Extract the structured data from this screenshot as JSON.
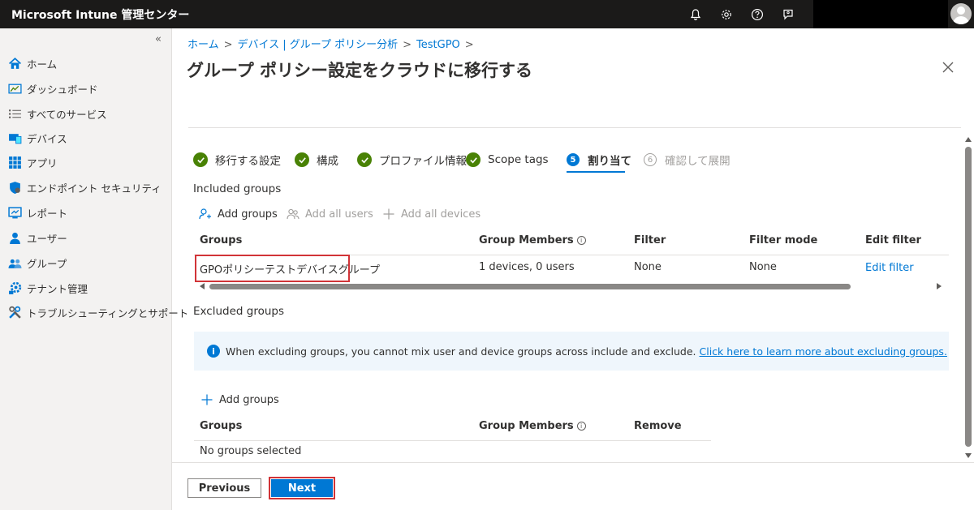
{
  "app": {
    "title": "Microsoft Intune 管理センター"
  },
  "topbar": {
    "icons": [
      "bell-icon",
      "gear-icon",
      "help-icon",
      "feedback-icon"
    ]
  },
  "sidebar": {
    "collapse": "«",
    "items": [
      {
        "label": "ホーム",
        "icon": "home-icon"
      },
      {
        "label": "ダッシュボード",
        "icon": "dashboard-icon"
      },
      {
        "label": "すべてのサービス",
        "icon": "list-icon"
      },
      {
        "label": "デバイス",
        "icon": "device-icon"
      },
      {
        "label": "アプリ",
        "icon": "apps-icon"
      },
      {
        "label": "エンドポイント セキュリティ",
        "icon": "shield-icon"
      },
      {
        "label": "レポート",
        "icon": "report-icon"
      },
      {
        "label": "ユーザー",
        "icon": "user-icon"
      },
      {
        "label": "グループ",
        "icon": "group-icon"
      },
      {
        "label": "テナント管理",
        "icon": "tenant-icon"
      },
      {
        "label": "トラブルシューティングとサポート",
        "icon": "tools-icon"
      }
    ]
  },
  "breadcrumb": [
    "ホーム",
    "デバイス | グループ ポリシー分析",
    "TestGPO"
  ],
  "page": {
    "title": "グループ ポリシー設定をクラウドに移行する",
    "more": "···"
  },
  "steps": [
    {
      "label": "移行する設定",
      "state": "done"
    },
    {
      "label": "構成",
      "state": "done"
    },
    {
      "label": "プロファイル情報",
      "state": "done"
    },
    {
      "label": "Scope tags",
      "state": "done"
    },
    {
      "label": "割り当て",
      "state": "active",
      "number": "5"
    },
    {
      "label": "確認して展開",
      "state": "pending",
      "number": "6"
    }
  ],
  "included": {
    "title": "Included groups",
    "commands": {
      "add_groups": "Add groups",
      "add_all_users": "Add all users",
      "add_all_devices": "Add all devices"
    },
    "columns": [
      "Groups",
      "Group Members",
      "Filter",
      "Filter mode",
      "Edit filter"
    ],
    "rows": [
      {
        "group": "GPOポリシーテストデバイスグループ",
        "members": "1 devices, 0 users",
        "filter": "None",
        "filter_mode": "None",
        "edit": "Edit filter"
      }
    ]
  },
  "excluded": {
    "title": "Excluded groups",
    "info": "When excluding groups, you cannot mix user and device groups across include and exclude.",
    "info_link": "Click here to learn more about excluding groups.",
    "add_groups": "Add groups",
    "columns": [
      "Groups",
      "Group Members",
      "Remove"
    ],
    "empty": "No groups selected"
  },
  "footer": {
    "previous": "Previous",
    "next": "Next"
  }
}
